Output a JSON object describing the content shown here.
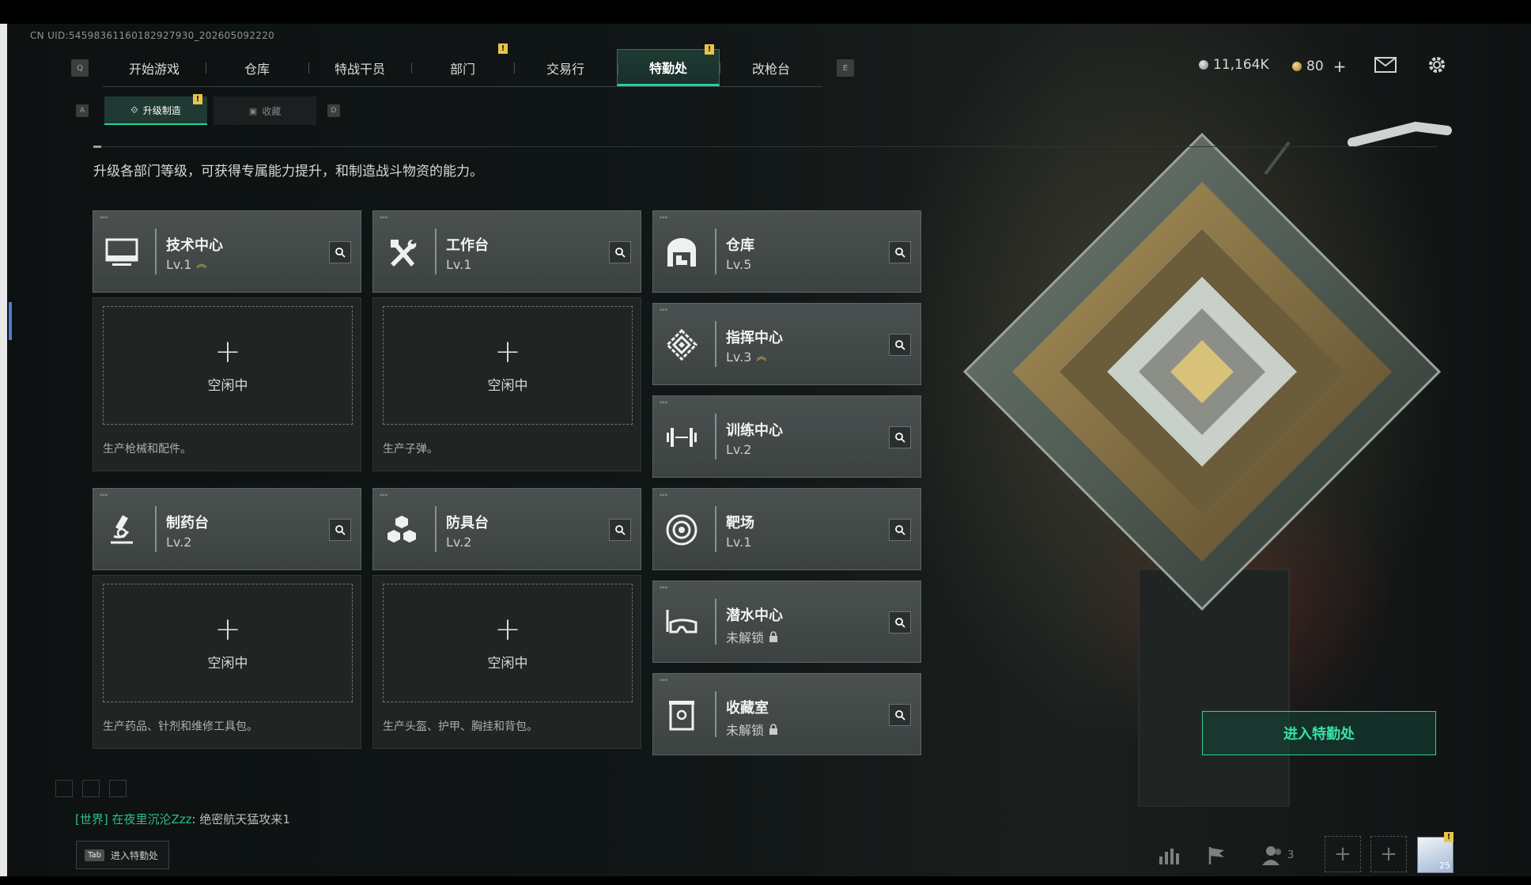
{
  "uid": "CN UID:54598361160182927930_202605092220",
  "nav": {
    "left_key": "Q",
    "right_key": "E",
    "tabs": [
      {
        "label": "开始游戏",
        "badge": ""
      },
      {
        "label": "仓库",
        "badge": ""
      },
      {
        "label": "特战干员",
        "badge": ""
      },
      {
        "label": "部门",
        "badge": "!"
      },
      {
        "label": "交易行",
        "badge": ""
      },
      {
        "label": "特勤处",
        "badge": "!",
        "active": true
      },
      {
        "label": "改枪台",
        "badge": ""
      }
    ]
  },
  "subnav": {
    "left_key": "A",
    "right_key": "D",
    "tabs": [
      {
        "label": "升级制造",
        "badge": "!",
        "active": true
      },
      {
        "label": "收藏",
        "badge": ""
      }
    ]
  },
  "currency": {
    "silver": "11,164K",
    "gold": "80",
    "add": "+"
  },
  "description": "升级各部门等级，可获得专属能力提升，和制造战斗物资的能力。",
  "departments": {
    "tech": {
      "title": "技术中心",
      "level": "Lv.1",
      "upgrade": true,
      "icon": "monitor-icon"
    },
    "workbench": {
      "title": "工作台",
      "level": "Lv.1",
      "icon": "hammer-wrench-icon"
    },
    "warehouse": {
      "title": "仓库",
      "level": "Lv.5",
      "icon": "warehouse-icon"
    },
    "command": {
      "title": "指挥中心",
      "level": "Lv.3",
      "upgrade": true,
      "icon": "command-chip-icon"
    },
    "training": {
      "title": "训练中心",
      "level": "Lv.2",
      "icon": "dumbbell-icon"
    },
    "pharmacy": {
      "title": "制药台",
      "level": "Lv.2",
      "icon": "microscope-icon"
    },
    "armor": {
      "title": "防具台",
      "level": "Lv.2",
      "icon": "cubes-icon"
    },
    "range": {
      "title": "靶场",
      "level": "Lv.1",
      "icon": "target-icon"
    },
    "diving": {
      "title": "潜水中心",
      "level": "未解锁",
      "locked": true,
      "icon": "diving-mask-icon"
    },
    "collection": {
      "title": "收藏室",
      "level": "未解锁",
      "locked": true,
      "icon": "trophy-case-icon"
    }
  },
  "slots": {
    "plus": "+",
    "idle_label": "空闲中",
    "tech_produce": "生产枪械和配件。",
    "workbench_produce": "生产子弹。",
    "pharmacy_produce": "生产药品、针剂和维修工具包。",
    "armor_produce": "生产头盔、护甲、胸挂和背包。"
  },
  "enter_button": "进入特勤处",
  "chat": {
    "channel": "[世界]",
    "name": "在夜里沉沦Zzz",
    "message": ": 绝密航天猛攻来1"
  },
  "tab_hint": {
    "key": "Tab",
    "label": "进入特勤处"
  },
  "bottom": {
    "friends_count": "3",
    "avatar_level": "25",
    "avatar_badge": "!"
  },
  "colors": {
    "accent": "#26d29b",
    "badge": "#e8c44a",
    "upgrade_arrow": "#e0b54a"
  }
}
